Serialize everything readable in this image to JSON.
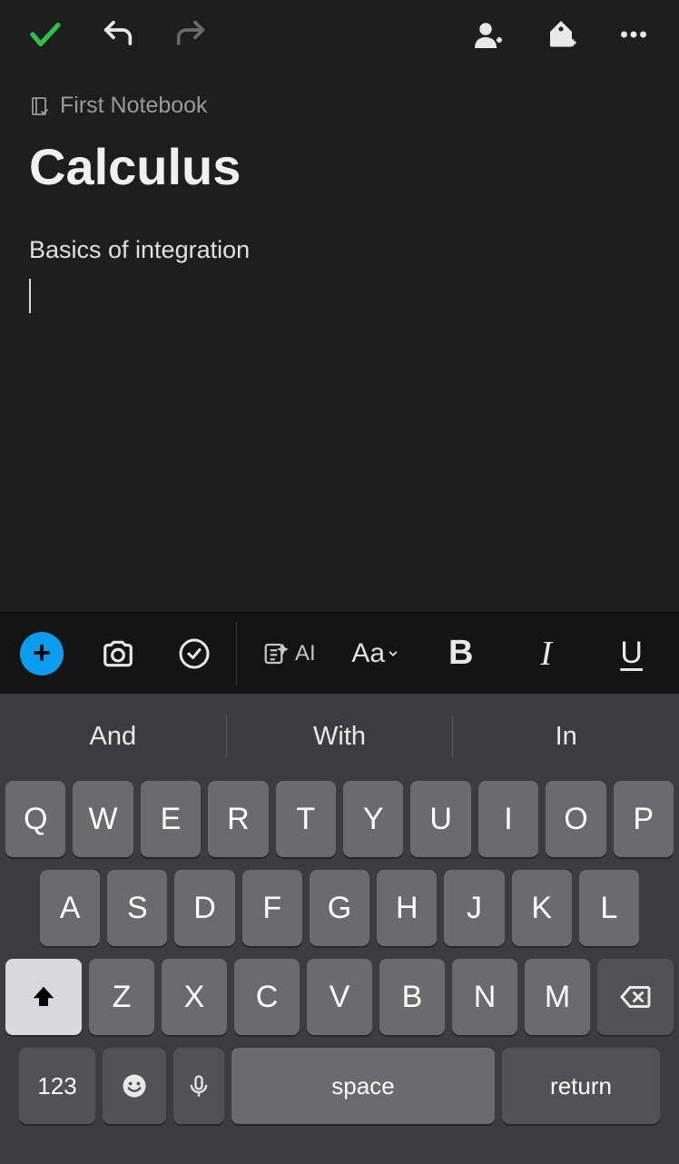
{
  "header": {
    "actions": [
      "done",
      "undo",
      "redo",
      "share",
      "tag",
      "more"
    ]
  },
  "notebook": {
    "name": "First Notebook"
  },
  "note": {
    "title": "Calculus",
    "body": "Basics of integration"
  },
  "toolbar": {
    "ai_label": "AI",
    "font_label": "Aa",
    "bold_label": "B",
    "italic_label": "I",
    "underline_label": "U"
  },
  "keyboard": {
    "suggestions": [
      "And",
      "With",
      "In"
    ],
    "row1": [
      "Q",
      "W",
      "E",
      "R",
      "T",
      "Y",
      "U",
      "I",
      "O",
      "P"
    ],
    "row2": [
      "A",
      "S",
      "D",
      "F",
      "G",
      "H",
      "J",
      "K",
      "L"
    ],
    "row3": [
      "Z",
      "X",
      "C",
      "V",
      "B",
      "N",
      "M"
    ],
    "numbers_label": "123",
    "space_label": "space",
    "return_label": "return"
  }
}
